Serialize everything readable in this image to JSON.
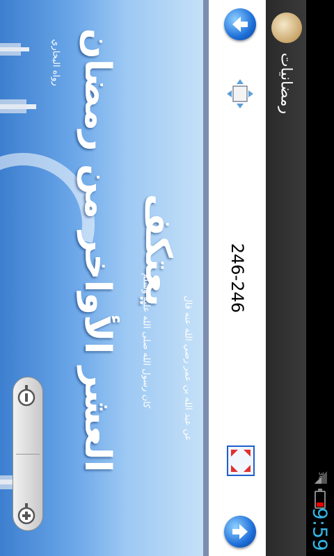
{
  "status_bar": {
    "time": "9:59",
    "network": "3G"
  },
  "action_bar": {
    "title": "رمضانيات",
    "icon": "app-logo-icon"
  },
  "toolbar": {
    "page_indicator": "246-246",
    "buttons": {
      "previous_page": "arrow-up-icon",
      "fit_width": "fit-width-icon",
      "fullscreen": "fullscreen-icon",
      "next_page": "arrow-down-icon"
    }
  },
  "document": {
    "headline_line1": "يعتكف",
    "headline_line2": "العشر الأواخر من رمضان",
    "subtitle_line1": "عن عبد الله بن عمر رضي الله عنه قال",
    "subtitle_line2": "كان رسول الله صلى الله عليه وسلم",
    "narrator": "رواه البخاري"
  },
  "zoom": {
    "zoom_out_icon": "zoom-out-icon",
    "zoom_in_icon": "zoom-in-icon"
  },
  "colors": {
    "accent": "#33b5e5",
    "button_blue": "#1e6fd9",
    "background_sky": "#9cc8f3"
  }
}
